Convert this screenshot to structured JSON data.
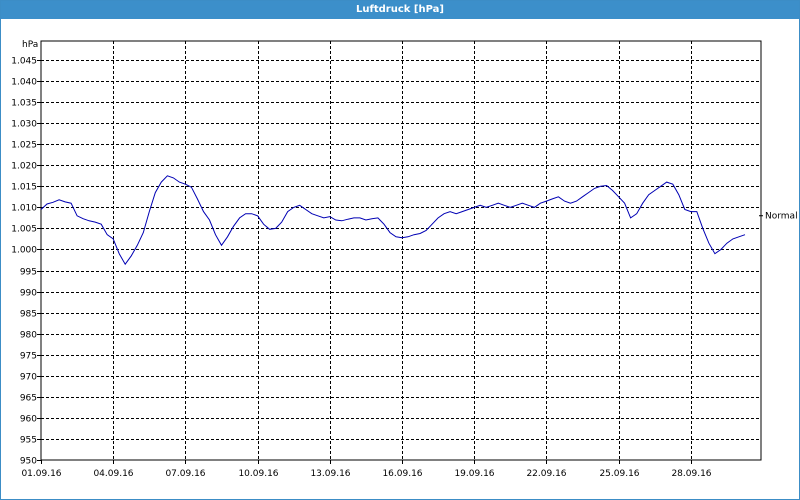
{
  "window": {
    "title": "Luftdruck [hPa]"
  },
  "chart_data": {
    "type": "line",
    "title": "Luftdruck [hPa]",
    "ylabel": "hPa",
    "xlabel": "",
    "ylim": [
      950,
      1045
    ],
    "xlim": [
      "2016-09-01",
      "2016-09-30 22:00"
    ],
    "grid": true,
    "y_ticks": [
      950,
      955,
      960,
      965,
      970,
      975,
      980,
      985,
      990,
      995,
      1000,
      1005,
      1010,
      1015,
      1020,
      1025,
      1030,
      1035,
      1040,
      1045
    ],
    "y_tick_labels": [
      "950",
      "955",
      "960",
      "965",
      "970",
      "975",
      "980",
      "985",
      "990",
      "995",
      "1.000",
      "1.005",
      "1.010",
      "1.015",
      "1.020",
      "1.025",
      "1.030",
      "1.035",
      "1.040",
      "1.045"
    ],
    "x_ticks": [
      "2016-09-01",
      "2016-09-04",
      "2016-09-07",
      "2016-09-10",
      "2016-09-13",
      "2016-09-16",
      "2016-09-19",
      "2016-09-22",
      "2016-09-25",
      "2016-09-28"
    ],
    "x_tick_labels": [
      "01.09.16",
      "04.09.16",
      "07.09.16",
      "10.09.16",
      "13.09.16",
      "16.09.16",
      "19.09.16",
      "22.09.16",
      "25.09.16",
      "28.09.16"
    ],
    "series": [
      {
        "color": "#0000b4",
        "end_label": "Normal",
        "points": [
          [
            "2016-09-01 00:00",
            1009.5
          ],
          [
            "2016-09-01 06:00",
            1010.8
          ],
          [
            "2016-09-01 12:00",
            1011.2
          ],
          [
            "2016-09-01 18:00",
            1011.8
          ],
          [
            "2016-09-02 00:00",
            1011.3
          ],
          [
            "2016-09-02 06:00",
            1011.0
          ],
          [
            "2016-09-02 12:00",
            1008.0
          ],
          [
            "2016-09-02 18:00",
            1007.3
          ],
          [
            "2016-09-03 00:00",
            1006.8
          ],
          [
            "2016-09-03 06:00",
            1006.5
          ],
          [
            "2016-09-03 12:00",
            1006.0
          ],
          [
            "2016-09-03 18:00",
            1003.5
          ],
          [
            "2016-09-04 00:00",
            1002.5
          ],
          [
            "2016-09-04 06:00",
            999.0
          ],
          [
            "2016-09-04 12:00",
            996.5
          ],
          [
            "2016-09-04 18:00",
            998.5
          ],
          [
            "2016-09-05 00:00",
            1001.0
          ],
          [
            "2016-09-05 06:00",
            1004.0
          ],
          [
            "2016-09-05 12:00",
            1009.0
          ],
          [
            "2016-09-05 18:00",
            1013.5
          ],
          [
            "2016-09-06 00:00",
            1016.0
          ],
          [
            "2016-09-06 06:00",
            1017.5
          ],
          [
            "2016-09-06 12:00",
            1017.0
          ],
          [
            "2016-09-06 18:00",
            1016.0
          ],
          [
            "2016-09-07 00:00",
            1015.5
          ],
          [
            "2016-09-07 06:00",
            1014.8
          ],
          [
            "2016-09-07 12:00",
            1012.0
          ],
          [
            "2016-09-07 18:00",
            1009.0
          ],
          [
            "2016-09-08 00:00",
            1007.0
          ],
          [
            "2016-09-08 06:00",
            1003.5
          ],
          [
            "2016-09-08 12:00",
            1001.0
          ],
          [
            "2016-09-08 18:00",
            1003.0
          ],
          [
            "2016-09-09 00:00",
            1005.5
          ],
          [
            "2016-09-09 06:00",
            1007.5
          ],
          [
            "2016-09-09 12:00",
            1008.5
          ],
          [
            "2016-09-09 18:00",
            1008.5
          ],
          [
            "2016-09-10 00:00",
            1008.0
          ],
          [
            "2016-09-10 06:00",
            1006.0
          ],
          [
            "2016-09-10 12:00",
            1004.8
          ],
          [
            "2016-09-10 18:00",
            1005.0
          ],
          [
            "2016-09-11 00:00",
            1006.5
          ],
          [
            "2016-09-11 06:00",
            1009.0
          ],
          [
            "2016-09-11 12:00",
            1010.0
          ],
          [
            "2016-09-11 18:00",
            1010.5
          ],
          [
            "2016-09-12 00:00",
            1009.5
          ],
          [
            "2016-09-12 06:00",
            1008.5
          ],
          [
            "2016-09-12 12:00",
            1008.0
          ],
          [
            "2016-09-12 18:00",
            1007.5
          ],
          [
            "2016-09-13 00:00",
            1007.8
          ],
          [
            "2016-09-13 06:00",
            1007.0
          ],
          [
            "2016-09-13 12:00",
            1006.8
          ],
          [
            "2016-09-13 18:00",
            1007.2
          ],
          [
            "2016-09-14 00:00",
            1007.5
          ],
          [
            "2016-09-14 06:00",
            1007.5
          ],
          [
            "2016-09-14 12:00",
            1007.0
          ],
          [
            "2016-09-14 18:00",
            1007.3
          ],
          [
            "2016-09-15 00:00",
            1007.5
          ],
          [
            "2016-09-15 06:00",
            1006.0
          ],
          [
            "2016-09-15 12:00",
            1004.0
          ],
          [
            "2016-09-15 18:00",
            1003.0
          ],
          [
            "2016-09-16 00:00",
            1002.8
          ],
          [
            "2016-09-16 06:00",
            1003.0
          ],
          [
            "2016-09-16 12:00",
            1003.5
          ],
          [
            "2016-09-16 18:00",
            1003.8
          ],
          [
            "2016-09-17 00:00",
            1004.5
          ],
          [
            "2016-09-17 06:00",
            1006.0
          ],
          [
            "2016-09-17 12:00",
            1007.5
          ],
          [
            "2016-09-17 18:00",
            1008.5
          ],
          [
            "2016-09-18 00:00",
            1009.0
          ],
          [
            "2016-09-18 06:00",
            1008.5
          ],
          [
            "2016-09-18 12:00",
            1009.0
          ],
          [
            "2016-09-18 18:00",
            1009.5
          ],
          [
            "2016-09-19 00:00",
            1010.0
          ],
          [
            "2016-09-19 06:00",
            1010.5
          ],
          [
            "2016-09-19 12:00",
            1010.0
          ],
          [
            "2016-09-19 18:00",
            1010.5
          ],
          [
            "2016-09-20 00:00",
            1011.0
          ],
          [
            "2016-09-20 06:00",
            1010.5
          ],
          [
            "2016-09-20 12:00",
            1010.0
          ],
          [
            "2016-09-20 18:00",
            1010.5
          ],
          [
            "2016-09-21 00:00",
            1011.0
          ],
          [
            "2016-09-21 06:00",
            1010.5
          ],
          [
            "2016-09-21 12:00",
            1010.0
          ],
          [
            "2016-09-21 18:00",
            1011.0
          ],
          [
            "2016-09-22 00:00",
            1011.5
          ],
          [
            "2016-09-22 06:00",
            1012.0
          ],
          [
            "2016-09-22 12:00",
            1012.5
          ],
          [
            "2016-09-22 18:00",
            1011.5
          ],
          [
            "2016-09-23 00:00",
            1011.0
          ],
          [
            "2016-09-23 06:00",
            1011.5
          ],
          [
            "2016-09-23 12:00",
            1012.5
          ],
          [
            "2016-09-23 18:00",
            1013.5
          ],
          [
            "2016-09-24 00:00",
            1014.5
          ],
          [
            "2016-09-24 06:00",
            1015.0
          ],
          [
            "2016-09-24 12:00",
            1015.2
          ],
          [
            "2016-09-24 18:00",
            1014.0
          ],
          [
            "2016-09-25 00:00",
            1012.5
          ],
          [
            "2016-09-25 06:00",
            1011.0
          ],
          [
            "2016-09-25 12:00",
            1007.5
          ],
          [
            "2016-09-25 18:00",
            1008.5
          ],
          [
            "2016-09-26 00:00",
            1011.0
          ],
          [
            "2016-09-26 06:00",
            1013.0
          ],
          [
            "2016-09-26 12:00",
            1014.0
          ],
          [
            "2016-09-26 18:00",
            1015.0
          ],
          [
            "2016-09-27 00:00",
            1016.0
          ],
          [
            "2016-09-27 06:00",
            1015.5
          ],
          [
            "2016-09-27 12:00",
            1013.0
          ],
          [
            "2016-09-27 18:00",
            1009.5
          ],
          [
            "2016-09-28 00:00",
            1009.0
          ],
          [
            "2016-09-28 06:00",
            1009.0
          ],
          [
            "2016-09-28 12:00",
            1005.0
          ],
          [
            "2016-09-28 18:00",
            1001.5
          ],
          [
            "2016-09-29 00:00",
            999.0
          ],
          [
            "2016-09-29 06:00",
            1000.0
          ],
          [
            "2016-09-29 12:00",
            1001.5
          ],
          [
            "2016-09-29 18:00",
            1002.5
          ],
          [
            "2016-09-30 00:00",
            1003.0
          ],
          [
            "2016-09-30 06:00",
            1003.5
          ]
        ]
      }
    ]
  }
}
